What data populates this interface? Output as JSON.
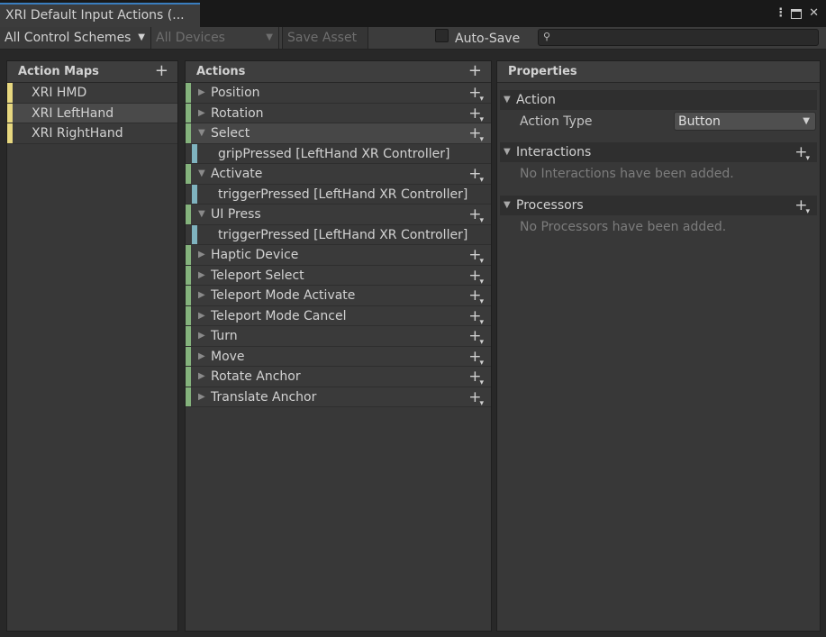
{
  "window": {
    "tab_title": "XRI Default Input Actions (..."
  },
  "toolbar": {
    "control_schemes": "All Control Schemes",
    "devices": "All Devices",
    "save_label": "Save Asset",
    "autosave_label": "Auto-Save",
    "search_value": ""
  },
  "action_maps": {
    "header": "Action Maps",
    "items": [
      {
        "label": "XRI HMD"
      },
      {
        "label": "XRI LeftHand"
      },
      {
        "label": "XRI RightHand"
      }
    ],
    "selected": "XRI LeftHand"
  },
  "actions": {
    "header": "Actions",
    "items": [
      {
        "label": "Position"
      },
      {
        "label": "Rotation"
      },
      {
        "label": "Select",
        "binding": "gripPressed [LeftHand XR Controller]"
      },
      {
        "label": "Activate",
        "binding": "triggerPressed [LeftHand XR Controller]"
      },
      {
        "label": "UI Press",
        "binding": "triggerPressed [LeftHand XR Controller]"
      },
      {
        "label": "Haptic Device"
      },
      {
        "label": "Teleport Select"
      },
      {
        "label": "Teleport Mode Activate"
      },
      {
        "label": "Teleport Mode Cancel"
      },
      {
        "label": "Turn"
      },
      {
        "label": "Move"
      },
      {
        "label": "Rotate Anchor"
      },
      {
        "label": "Translate Anchor"
      }
    ],
    "selected": "Select"
  },
  "properties": {
    "header": "Properties",
    "action_section": "Action",
    "action_type_label": "Action Type",
    "action_type_value": "Button",
    "interactions_section": "Interactions",
    "interactions_empty": "No Interactions have been added.",
    "processors_section": "Processors",
    "processors_empty": "No Processors have been added."
  },
  "colors": {
    "map_accent": "#e7d77f",
    "action_accent": "#84b27c",
    "binding_accent": "#7fb3bf"
  }
}
